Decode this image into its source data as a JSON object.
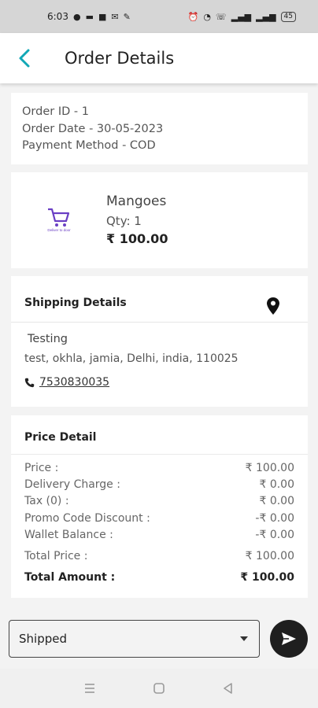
{
  "status_bar": {
    "time": "6:03",
    "left_icons": [
      "chat-icon",
      "message-icon",
      "app-icon",
      "gmail-icon",
      "app2-icon"
    ],
    "right_icons": [
      "alarm-icon",
      "wifi-icon",
      "volte-icon",
      "signal-icon",
      "signal2-icon"
    ],
    "battery": "45"
  },
  "header": {
    "title": "Order Details"
  },
  "order_info": {
    "order_id": "Order ID - 1",
    "order_date": "Order Date - 30-05-2023",
    "payment_method": "Payment Method - COD"
  },
  "product": {
    "name": "Mangoes",
    "qty": "Qty:  1",
    "price": "₹ 100.00",
    "thumb_caption": "Deliver to door"
  },
  "shipping": {
    "heading": "Shipping Details",
    "name": "Testing",
    "address": "test, okhla, jamia, Delhi, india, 110025",
    "phone": "7530830035"
  },
  "price_detail": {
    "heading": "Price Detail",
    "rows": [
      {
        "label": "Price :",
        "value": "₹ 100.00"
      },
      {
        "label": "Delivery Charge :",
        "value": "₹ 0.00"
      },
      {
        "label": "Tax (0) :",
        "value": "₹ 0.00"
      },
      {
        "label": "Promo Code Discount :",
        "value": "-₹ 0.00"
      },
      {
        "label": "Wallet Balance :",
        "value": "-₹ 0.00"
      },
      {
        "label": "Total Price :",
        "value": "₹ 100.00"
      }
    ],
    "total_label": "Total Amount :",
    "total_value": "₹ 100.00"
  },
  "status_dropdown": {
    "selected": "Shipped"
  },
  "colors": {
    "accent": "#12a8b6",
    "send_button": "#1f1f1f"
  }
}
